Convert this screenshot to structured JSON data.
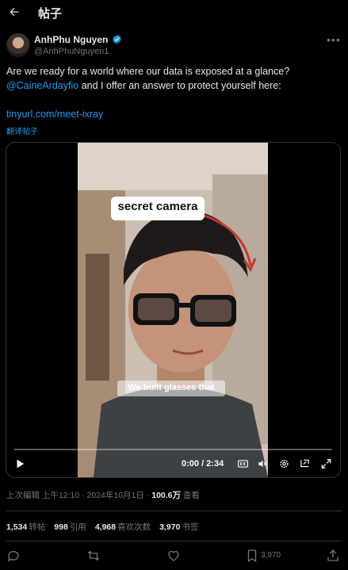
{
  "header": {
    "title": "帖子"
  },
  "author": {
    "name": "AnhPhu Nguyen",
    "handle": "@AnhPhuNguyen1"
  },
  "tweet": {
    "text_plain_1": "Are we ready for a world where our data is exposed at a glance?",
    "mention": "@CaineArdayfio",
    "text_plain_2": " and I offer an answer to protect yourself here:",
    "link": "tinyurl.com/meet-ixray",
    "translate": "翻译帖子"
  },
  "video": {
    "overlay_label": "secret camera",
    "caption": "We built glasses that",
    "time": "0:00 / 2:34",
    "progress": 0
  },
  "meta": {
    "prefix": "上次编辑 上午12:10 · 2024年10月1日 · ",
    "views": "100.6万",
    "views_label": " 查看"
  },
  "stats": {
    "reposts": "1,534",
    "reposts_label": "转帖",
    "quotes": "998",
    "quotes_label": "引用",
    "likes": "4,968",
    "likes_label": "喜欢次数",
    "bookmarks": "3,970",
    "bookmarks_label": "书签"
  },
  "actions": {
    "bookmark_count": "3,970"
  },
  "colors": {
    "accent": "#1d9bf0",
    "muted": "#71767b",
    "text": "#e7e9ea",
    "border": "#2f3336"
  }
}
